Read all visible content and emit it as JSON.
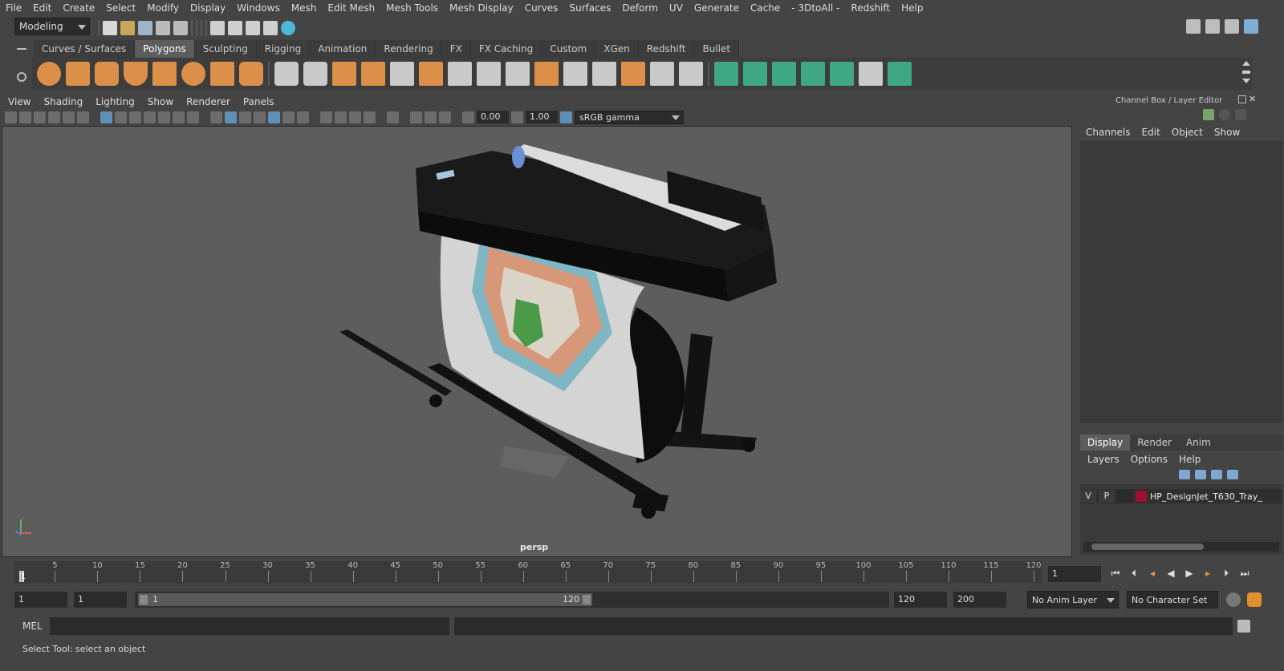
{
  "menus": [
    "File",
    "Edit",
    "Create",
    "Select",
    "Modify",
    "Display",
    "Windows",
    "Mesh",
    "Edit Mesh",
    "Mesh Tools",
    "Mesh Display",
    "Curves",
    "Surfaces",
    "Deform",
    "UV",
    "Generate",
    "Cache",
    "- 3DtoAll -",
    "Redshift",
    "Help"
  ],
  "mode_selector": "Modeling",
  "shelf_tabs": [
    "Curves / Surfaces",
    "Polygons",
    "Sculpting",
    "Rigging",
    "Animation",
    "Rendering",
    "FX",
    "FX Caching",
    "Custom",
    "XGen",
    "Redshift",
    "Bullet"
  ],
  "active_shelf_tab": "Polygons",
  "panel_menus": [
    "View",
    "Shading",
    "Lighting",
    "Show",
    "Renderer",
    "Panels"
  ],
  "viewport_toolbar": {
    "exposure": "0.00",
    "gamma": "1.00",
    "color_space": "sRGB gamma"
  },
  "viewport": {
    "camera_label": "persp"
  },
  "channel_box": {
    "title": "Channel Box / Layer Editor",
    "menus": [
      "Channels",
      "Edit",
      "Object",
      "Show"
    ]
  },
  "layer_editor": {
    "tabs": [
      "Display",
      "Render",
      "Anim"
    ],
    "active_tab": "Display",
    "menus": [
      "Layers",
      "Options",
      "Help"
    ],
    "layer": {
      "visible": "V",
      "playback": "P",
      "name": "HP_DesignJet_T630_Tray_",
      "color": "#9b1030"
    }
  },
  "timeline": {
    "ticks": [
      1,
      5,
      10,
      15,
      20,
      25,
      30,
      35,
      40,
      45,
      50,
      55,
      60,
      65,
      70,
      75,
      80,
      85,
      90,
      95,
      100,
      105,
      110,
      115,
      120
    ],
    "current_frame_field": "1"
  },
  "range": {
    "start": "1",
    "playback_start": "1",
    "slider_start": "1",
    "slider_end": "120",
    "playback_end": "120",
    "end": "200",
    "anim_layer": "No Anim Layer",
    "character_set": "No Character Set"
  },
  "command_line": {
    "label": "MEL"
  },
  "help_line": "Select Tool: select an object",
  "colors": {
    "accent": "#5d5d5d",
    "polygon_icon": "#e8964a",
    "green_icon": "#3fb08a"
  }
}
